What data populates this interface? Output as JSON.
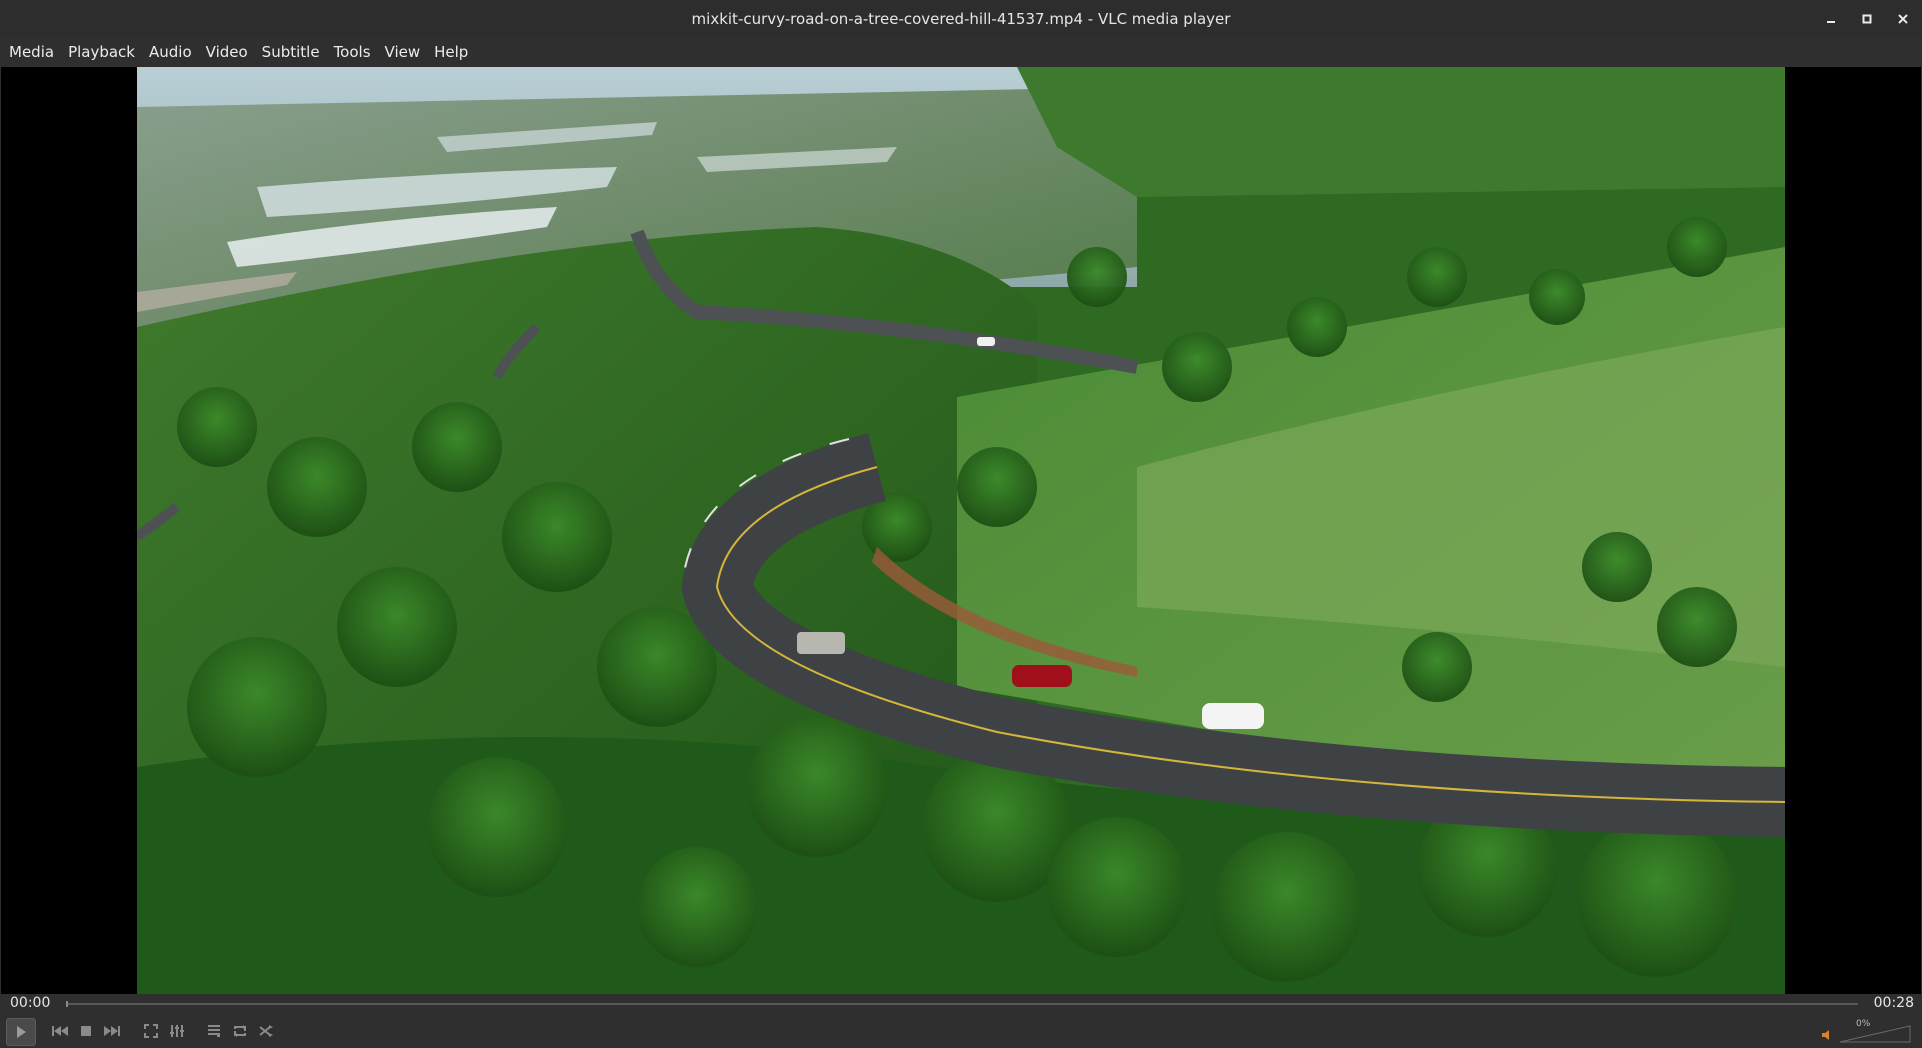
{
  "window": {
    "title": "mixkit-curvy-road-on-a-tree-covered-hill-41537.mp4 - VLC media player"
  },
  "menu": {
    "items": [
      {
        "label": "Media"
      },
      {
        "label": "Playback"
      },
      {
        "label": "Audio"
      },
      {
        "label": "Video"
      },
      {
        "label": "Subtitle"
      },
      {
        "label": "Tools"
      },
      {
        "label": "View"
      },
      {
        "label": "Help"
      }
    ]
  },
  "playback": {
    "elapsed": "00:00",
    "duration": "00:28",
    "progress_fraction": 0.0
  },
  "volume": {
    "label": "0%",
    "level_percent": 0
  },
  "controls": {
    "icons": [
      "play-icon",
      "previous-icon",
      "stop-icon",
      "next-icon",
      "fullscreen-icon",
      "extended-settings-icon",
      "playlist-icon",
      "loop-icon",
      "shuffle-icon",
      "volume-icon"
    ]
  },
  "colors": {
    "chrome": "#2f2f2f",
    "video_bg": "#000000",
    "text": "#e8e8e8",
    "volume_accent": "#d9822b"
  }
}
